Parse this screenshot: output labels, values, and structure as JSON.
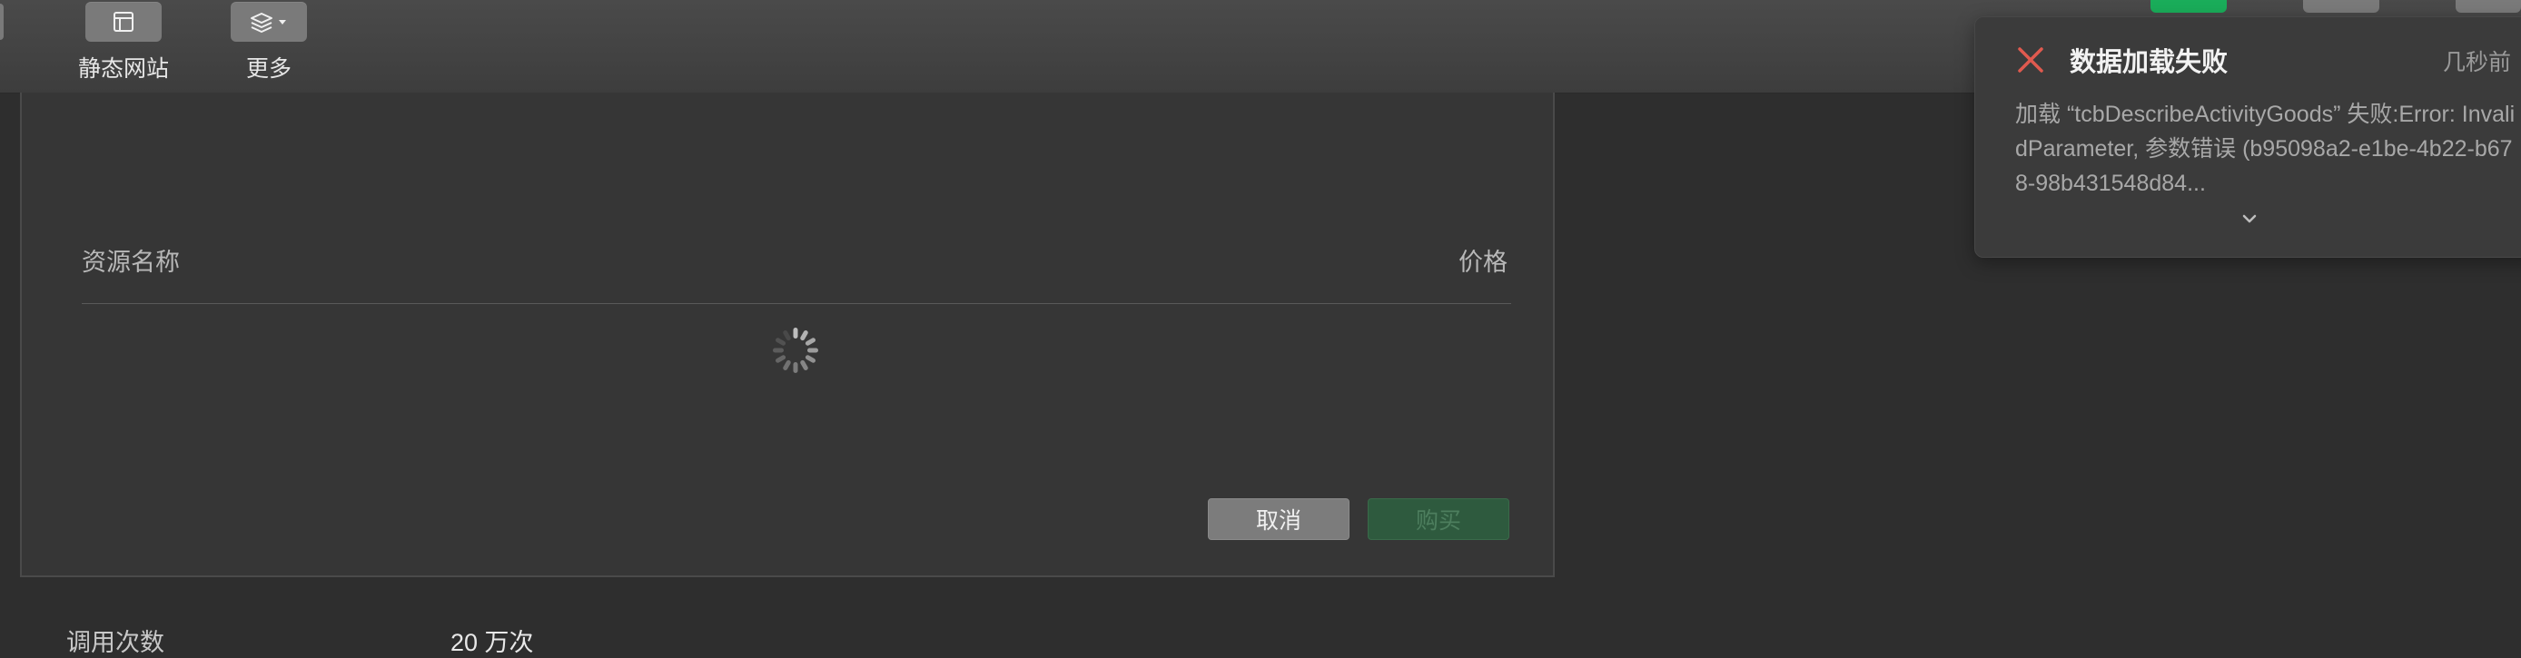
{
  "toolbar": {
    "static_site_label": "静态网站",
    "more_label": "更多"
  },
  "dialog": {
    "col_resource": "资源名称",
    "col_price": "价格",
    "cancel_label": "取消",
    "buy_label": "购买"
  },
  "usage": {
    "label": "调用次数",
    "value": "20 万次"
  },
  "notification": {
    "title": "数据加载失败",
    "time": "几秒前",
    "message": "加载 “tcbDescribeActivityGoods” 失败:Error: InvalidParameter, 参数错误 (b95098a2-e1be-4b22-b678-98b431548d84..."
  },
  "colors": {
    "error_icon": "#e05a4f",
    "buy_button": "#2e5a3e",
    "accent_green": "#1aad5a"
  },
  "icons": [
    "static-site-icon",
    "layers-icon",
    "close-icon",
    "chevron-down-icon",
    "loading-spinner"
  ]
}
